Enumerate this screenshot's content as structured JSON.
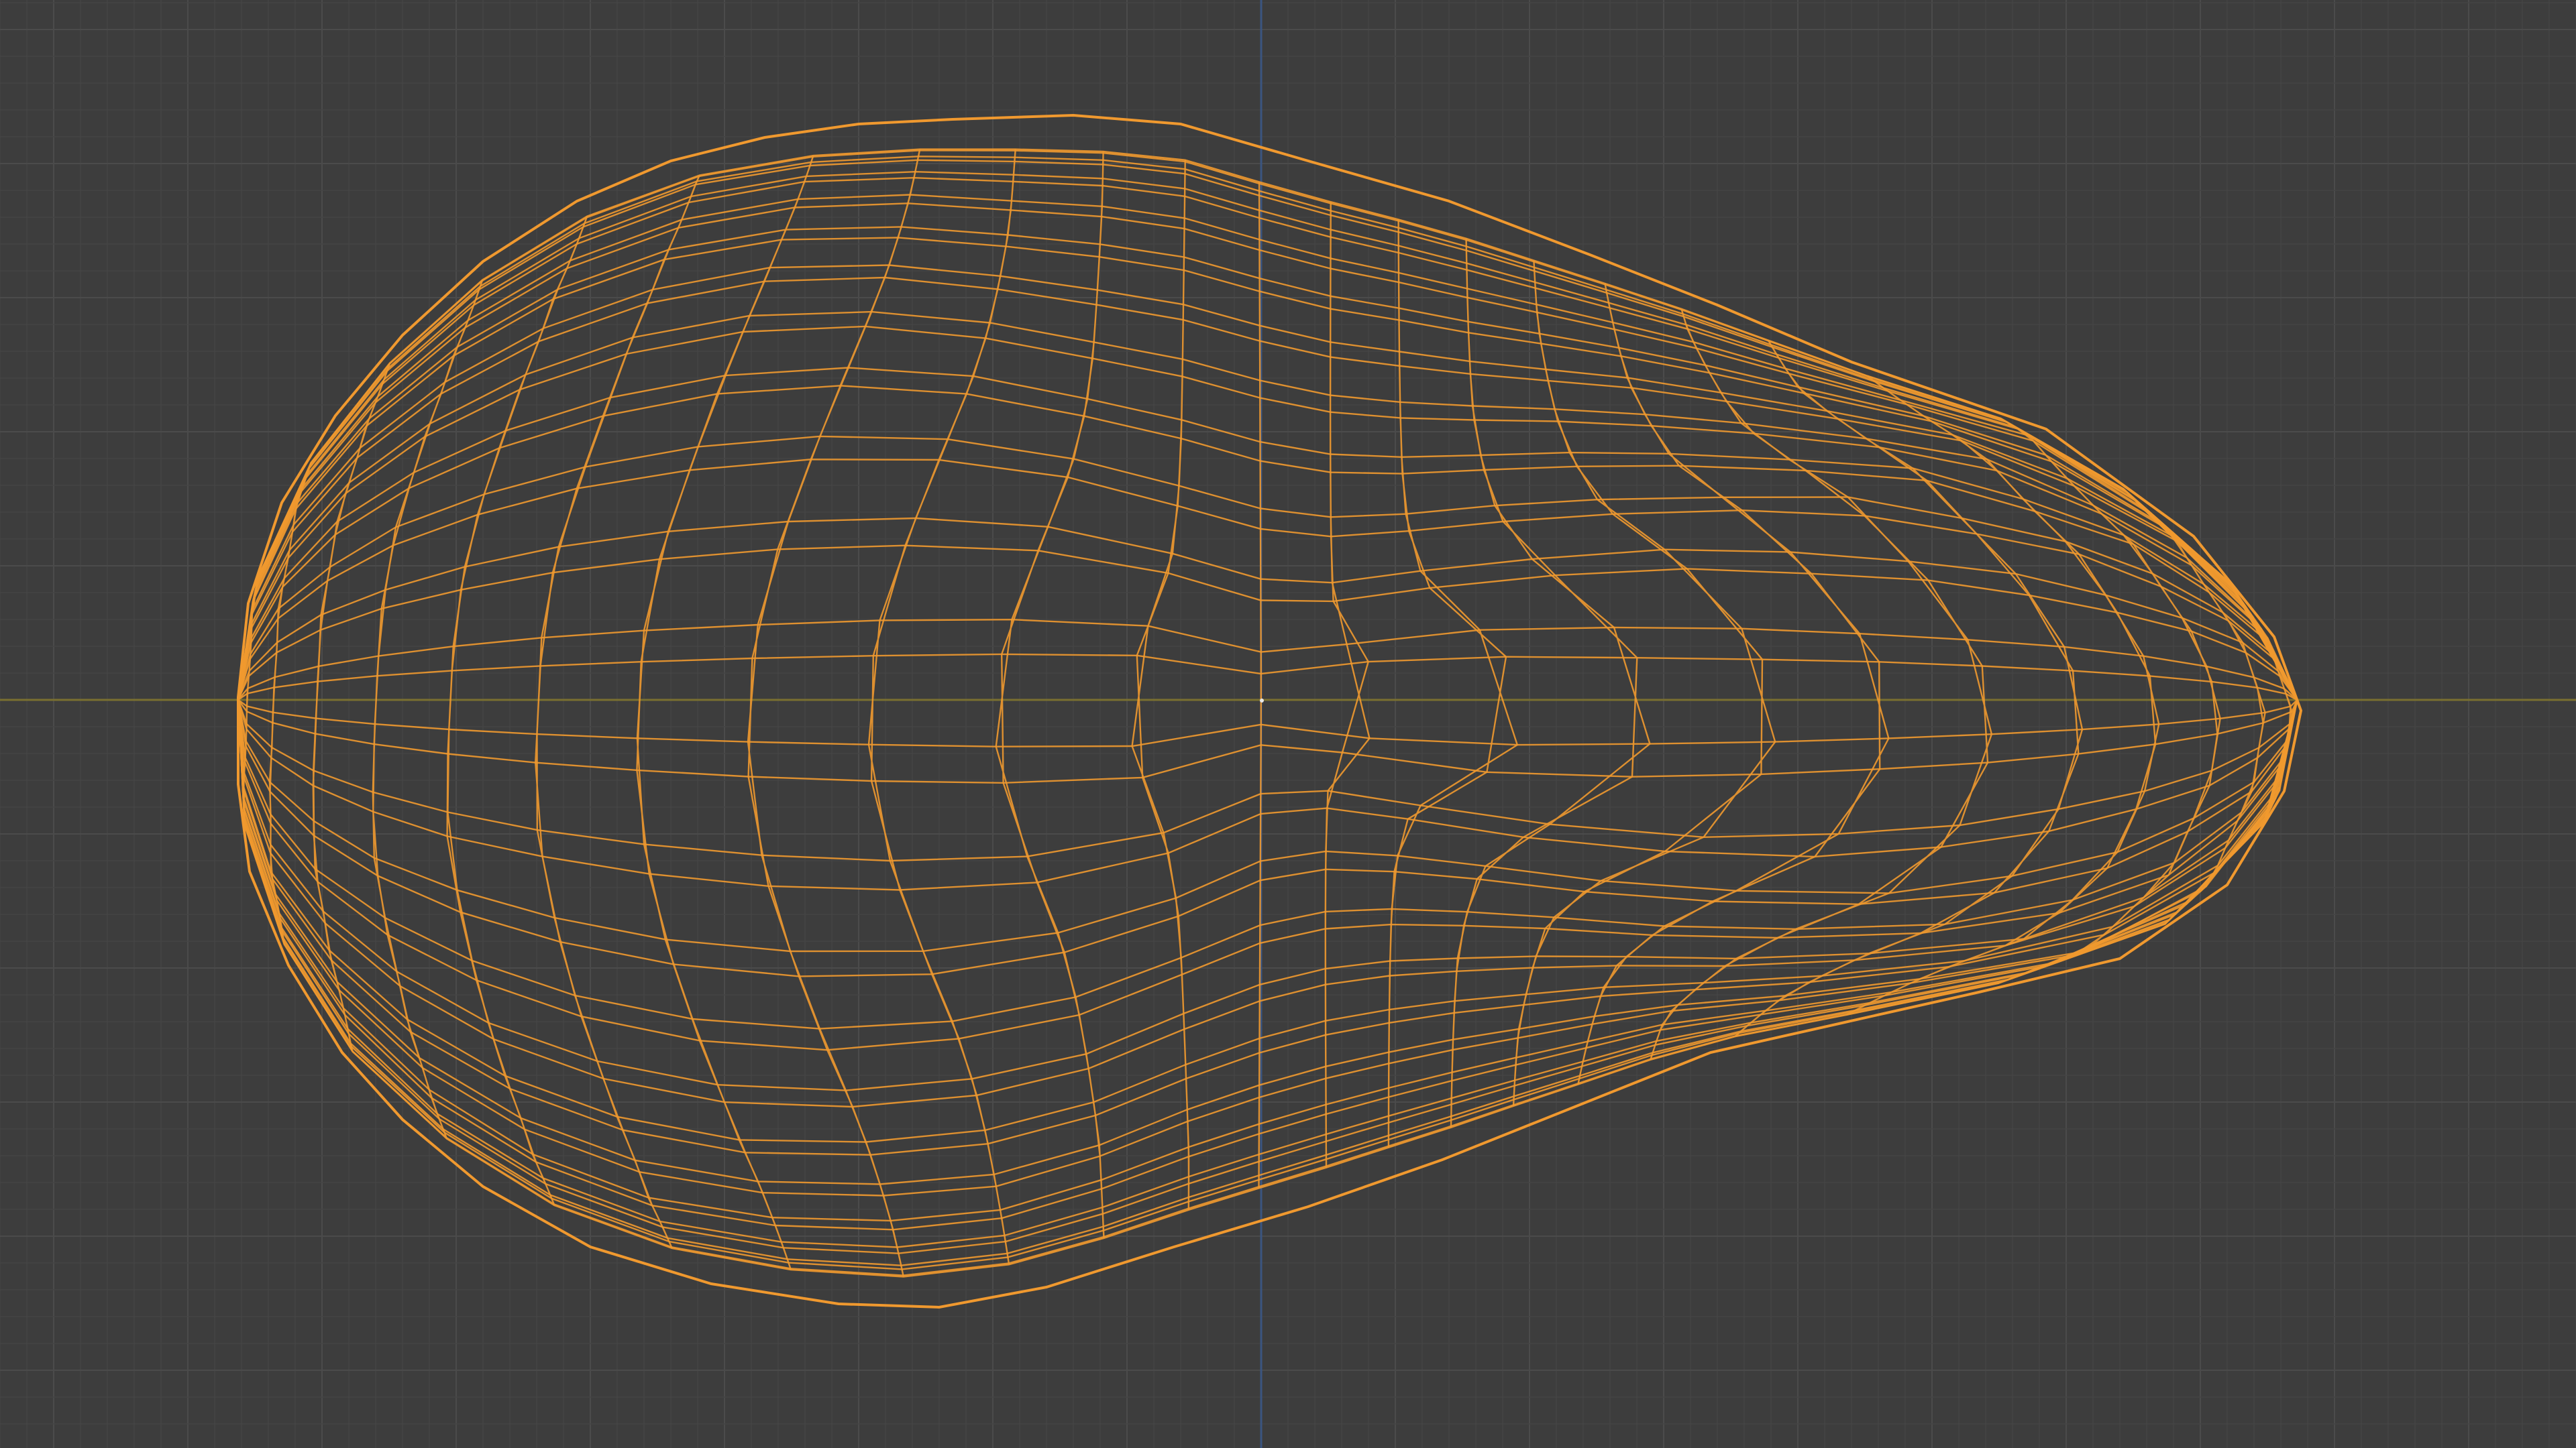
{
  "viewport": {
    "mode": "wireframe",
    "background_color": "#3d3d3d",
    "grid_minor_color": "#444444",
    "grid_major_color": "#4b4b4b",
    "x_axis_color": "#7a7030",
    "y_axis_color": "#3b5580",
    "wire_color": "#f0992f",
    "origin_marker_color": "#e8e8e8"
  },
  "mesh": {
    "object": "deformed-sphere",
    "selected": true,
    "longitude_segments": 44,
    "latitude_rings": 24
  }
}
